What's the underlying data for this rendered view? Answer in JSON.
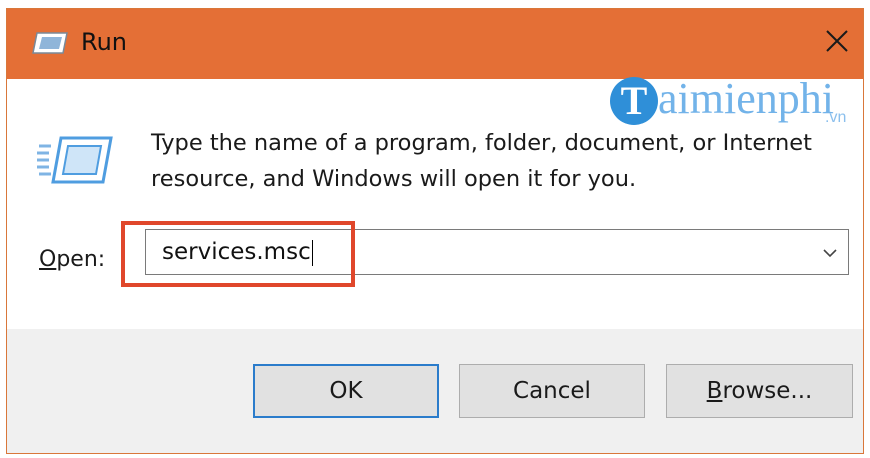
{
  "window": {
    "title": "Run",
    "titlebar_color": "#e46f36"
  },
  "watermark": {
    "initial": "T",
    "text": "aimienphi",
    "suffix": ".vn"
  },
  "description": {
    "line1": "Type the name of a program, folder, document, or Internet",
    "line2": "resource, and Windows will open it for you."
  },
  "open_field": {
    "label_access_key": "O",
    "label_rest": "pen:",
    "value": "services.msc"
  },
  "buttons": {
    "ok": "OK",
    "cancel": "Cancel",
    "browse_access_key": "B",
    "browse_rest": "rowse..."
  },
  "colors": {
    "highlight": "#e0472b",
    "ok_border": "#2b7ccb"
  },
  "icons": {
    "title": "run-icon",
    "close": "close-icon",
    "dropdown": "chevron-down-icon"
  }
}
